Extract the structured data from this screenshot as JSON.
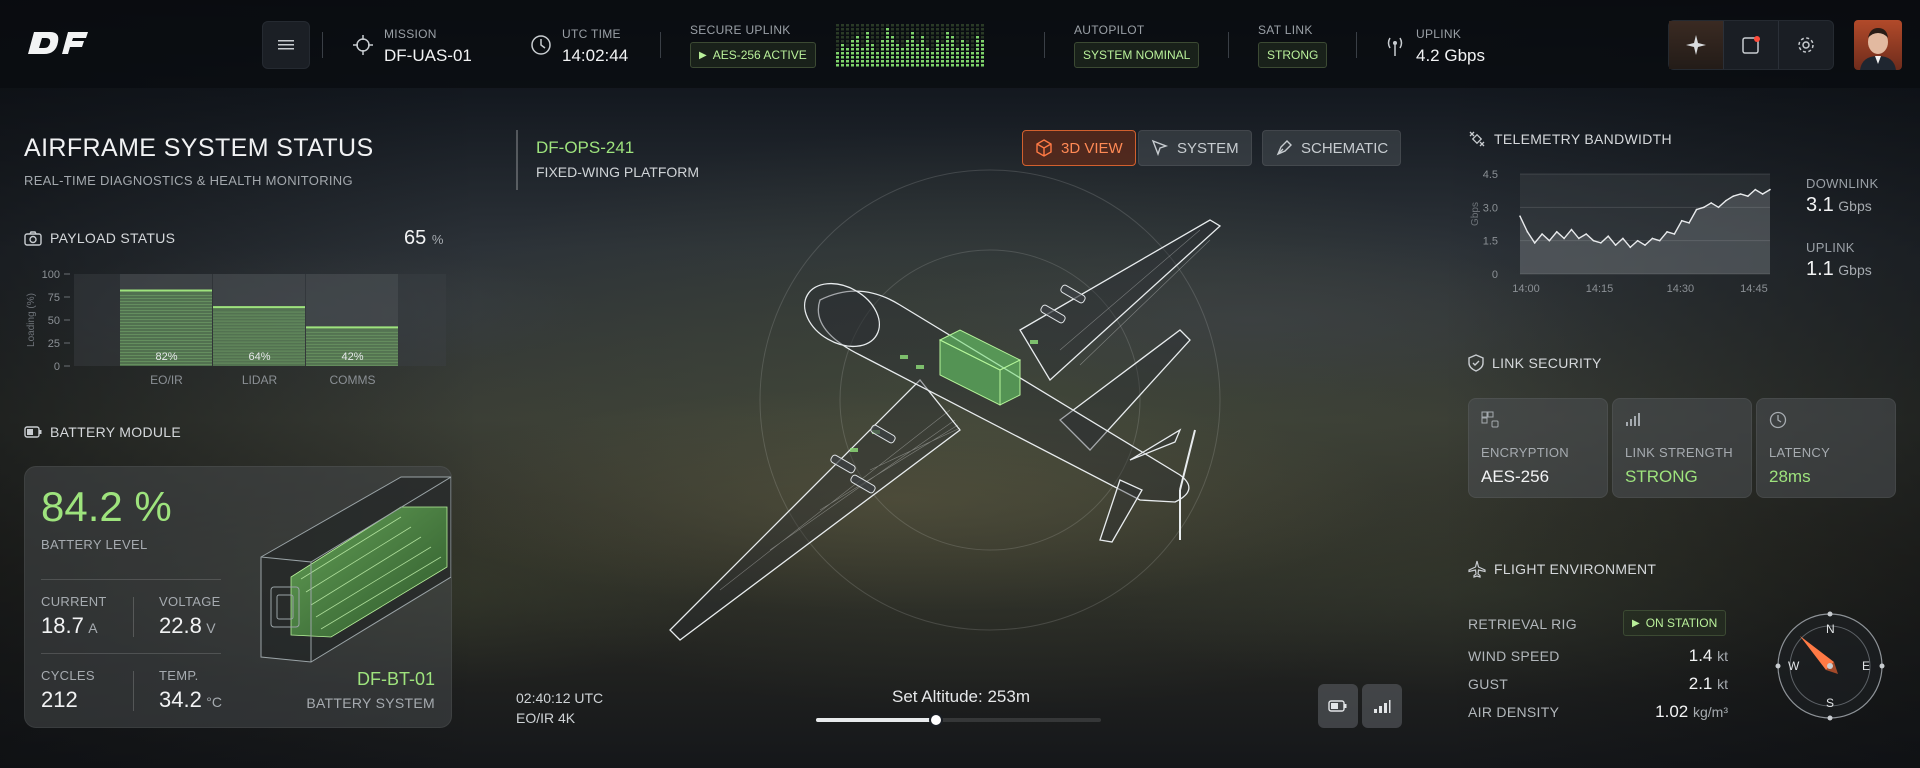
{
  "topbar": {
    "logo_text": "DF",
    "mission": {
      "label": "MISSION",
      "value": "DF-UAS-01"
    },
    "utc": {
      "label": "UTC TIME",
      "value": "14:02:44"
    },
    "uplink_secure": {
      "label": "SECURE UPLINK",
      "chip": "AES-256 ACTIVE"
    },
    "autopilot": {
      "label": "AUTOPILOT",
      "chip": "SYSTEM NOMINAL"
    },
    "satlink": {
      "label": "SAT LINK",
      "chip": "STRONG"
    },
    "uplink": {
      "label": "UPLINK",
      "value": "4.2 Gbps"
    },
    "icons": [
      "menu-icon",
      "crosshair-icon",
      "clock-icon",
      "play-icon",
      "antenna-icon",
      "sparkle-icon",
      "alert-square-icon",
      "gear-icon"
    ]
  },
  "header": {
    "title": "AIRFRAME SYSTEM STATUS",
    "subtitle": "REAL-TIME DIAGNOSTICS & HEALTH MONITORING"
  },
  "payload": {
    "label": "PAYLOAD STATUS",
    "percent": "65",
    "percent_unit": "%",
    "ylabel": "Loading (%)",
    "ticks": [
      "100",
      "75",
      "50",
      "25",
      "0"
    ],
    "bars": [
      {
        "name": "EO/IR",
        "value": 82,
        "label": "82%"
      },
      {
        "name": "LIDAR",
        "value": 64,
        "label": "64%"
      },
      {
        "name": "COMMS",
        "value": 42,
        "label": "42%"
      }
    ]
  },
  "battery": {
    "label": "BATTERY MODULE",
    "level": "84.2 %",
    "level_label": "BATTERY LEVEL",
    "current": {
      "label": "CURRENT",
      "value": "18.7",
      "unit": "A"
    },
    "voltage": {
      "label": "VOLTAGE",
      "value": "22.8",
      "unit": "V"
    },
    "cycles": {
      "label": "CYCLES",
      "value": "212"
    },
    "temp": {
      "label": "TEMP.",
      "value": "34.2",
      "unit": "°C"
    },
    "id": "DF-BT-01",
    "system": "BATTERY SYSTEM"
  },
  "aircraft": {
    "id": "DF-OPS-241",
    "type": "FIXED-WING PLATFORM",
    "views": [
      "3D VIEW",
      "SYSTEM",
      "SCHEMATIC"
    ],
    "active_view": "3D VIEW",
    "timestamp": "02:40:12 UTC",
    "sensor": "EO/IR 4K",
    "altitude_label": "Set Altitude: 253m",
    "altitude_fraction": 0.42
  },
  "telemetry": {
    "label": "TELEMETRY BANDWIDTH",
    "downlink": {
      "label": "DOWNLINK",
      "value": "3.1",
      "unit": "Gbps"
    },
    "uplink": {
      "label": "UPLINK",
      "value": "1.1",
      "unit": "Gbps"
    }
  },
  "chart_data": {
    "type": "line",
    "title": "",
    "xlabel": "",
    "ylabel": "Gbps",
    "x": [
      "14:00",
      "14:02",
      "14:04",
      "14:05",
      "14:07",
      "14:08",
      "14:10",
      "14:11",
      "14:13",
      "14:14",
      "14:15",
      "14:16",
      "14:18",
      "14:19",
      "14:20",
      "14:22",
      "14:23",
      "14:25",
      "14:26",
      "14:28",
      "14:29",
      "14:30",
      "14:31",
      "14:33",
      "14:34",
      "14:36",
      "14:37",
      "14:39",
      "14:40",
      "14:42",
      "14:43",
      "14:45",
      "14:46",
      "14:48",
      "14:50"
    ],
    "values": [
      2.6,
      1.9,
      1.4,
      1.8,
      1.5,
      1.9,
      1.6,
      2.0,
      1.6,
      1.8,
      1.5,
      1.4,
      1.7,
      1.3,
      1.6,
      1.2,
      1.5,
      1.3,
      1.6,
      1.5,
      1.9,
      1.8,
      2.4,
      2.3,
      2.9,
      3.0,
      3.2,
      3.0,
      3.3,
      3.5,
      3.6,
      3.5,
      3.8,
      3.6,
      3.8
    ],
    "ylim": [
      0,
      4.5
    ],
    "yticks": [
      "4.5",
      "3.0",
      "1.5",
      "0"
    ],
    "xticks": [
      "14:00",
      "14:15",
      "14:30",
      "14:45"
    ],
    "grid": true
  },
  "link_security": {
    "label": "LINK SECURITY",
    "cards": [
      {
        "label": "ENCRYPTION",
        "value": "AES-256"
      },
      {
        "label": "LINK STRENGTH",
        "value": "STRONG"
      },
      {
        "label": "LATENCY",
        "value": "28ms"
      }
    ]
  },
  "flight_env": {
    "label": "FLIGHT ENVIRONMENT",
    "rig_label": "RETRIEVAL RIG",
    "rig_status": "ON STATION",
    "wind": {
      "label": "WIND SPEED",
      "value": "1.4",
      "unit": "kt"
    },
    "gust": {
      "label": "GUST",
      "value": "2.1",
      "unit": "kt"
    },
    "density": {
      "label": "AIR DENSITY",
      "value": "1.02",
      "unit": "kg/m³"
    },
    "compass": {
      "n": "N",
      "e": "E",
      "s": "S",
      "w": "W"
    }
  },
  "colors": {
    "accent_green": "#9ee37d",
    "accent_orange": "#ff7a45",
    "panel": "#1a1e24"
  }
}
